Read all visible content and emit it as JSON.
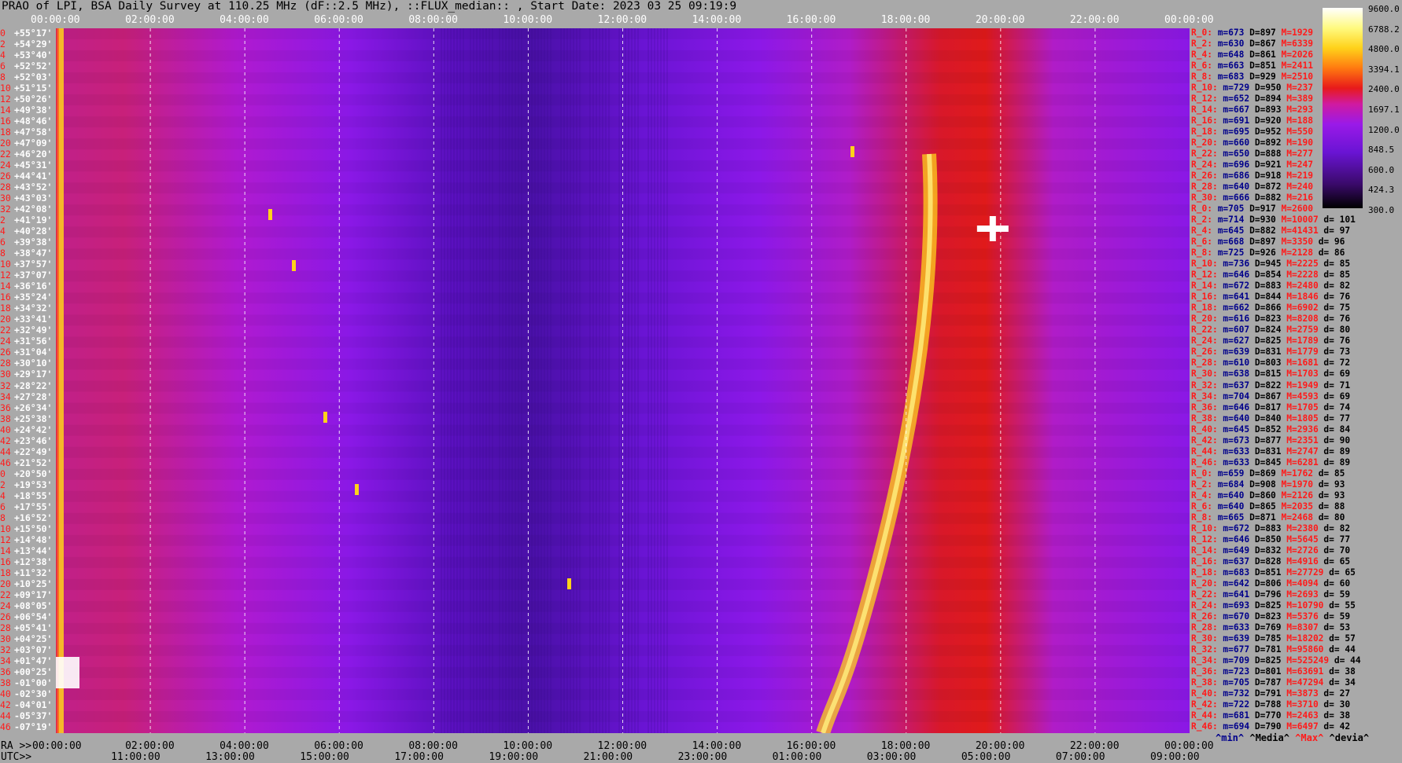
{
  "title": "PRAO of LPI, BSA Daily Survey at 110.25 MHz (dF::2.5 MHz), ::FLUX_median:: , Start Date: 2023 03 25 09:19:9",
  "top_ticks": [
    "00:00:00",
    "02:00:00",
    "04:00:00",
    "06:00:00",
    "08:00:00",
    "10:00:00",
    "12:00:00",
    "14:00:00",
    "16:00:00",
    "18:00:00",
    "20:00:00",
    "22:00:00",
    "00:00:00"
  ],
  "bottom_ticks_ra_prefix": "RA >>",
  "bottom_ticks": [
    "00:00:00",
    "02:00:00",
    "04:00:00",
    "06:00:00",
    "08:00:00",
    "10:00:00",
    "12:00:00",
    "14:00:00",
    "16:00:00",
    "18:00:00",
    "20:00:00",
    "22:00:00",
    "00:00:00"
  ],
  "utc_prefix": "UTC>>",
  "utc_ticks": [
    "11:00:00",
    "13:00:00",
    "15:00:00",
    "17:00:00",
    "19:00:00",
    "21:00:00",
    "23:00:00",
    "01:00:00",
    "03:00:00",
    "05:00:00",
    "07:00:00",
    "09:00:00"
  ],
  "declinations": [
    {
      "row": "0",
      "dec": "+55°17'"
    },
    {
      "row": "2",
      "dec": "+54°29'"
    },
    {
      "row": "4",
      "dec": "+53°40'"
    },
    {
      "row": "6",
      "dec": "+52°52'"
    },
    {
      "row": "8",
      "dec": "+52°03'"
    },
    {
      "row": "10",
      "dec": "+51°15'"
    },
    {
      "row": "12",
      "dec": "+50°26'"
    },
    {
      "row": "14",
      "dec": "+49°38'"
    },
    {
      "row": "16",
      "dec": "+48°46'"
    },
    {
      "row": "18",
      "dec": "+47°58'"
    },
    {
      "row": "20",
      "dec": "+47°09'"
    },
    {
      "row": "22",
      "dec": "+46°20'"
    },
    {
      "row": "24",
      "dec": "+45°31'"
    },
    {
      "row": "26",
      "dec": "+44°41'"
    },
    {
      "row": "28",
      "dec": "+43°52'"
    },
    {
      "row": "30",
      "dec": "+43°03'"
    },
    {
      "row": "32",
      "dec": "+42°08'"
    },
    {
      "row": "2",
      "dec": "+41°19'"
    },
    {
      "row": "4",
      "dec": "+40°28'"
    },
    {
      "row": "6",
      "dec": "+39°38'"
    },
    {
      "row": "8",
      "dec": "+38°47'"
    },
    {
      "row": "10",
      "dec": "+37°57'"
    },
    {
      "row": "12",
      "dec": "+37°07'"
    },
    {
      "row": "14",
      "dec": "+36°16'"
    },
    {
      "row": "16",
      "dec": "+35°24'"
    },
    {
      "row": "18",
      "dec": "+34°32'"
    },
    {
      "row": "20",
      "dec": "+33°41'"
    },
    {
      "row": "22",
      "dec": "+32°49'"
    },
    {
      "row": "24",
      "dec": "+31°56'"
    },
    {
      "row": "26",
      "dec": "+31°04'"
    },
    {
      "row": "28",
      "dec": "+30°10'"
    },
    {
      "row": "30",
      "dec": "+29°17'"
    },
    {
      "row": "32",
      "dec": "+28°22'"
    },
    {
      "row": "34",
      "dec": "+27°28'"
    },
    {
      "row": "36",
      "dec": "+26°34'"
    },
    {
      "row": "38",
      "dec": "+25°38'"
    },
    {
      "row": "40",
      "dec": "+24°42'"
    },
    {
      "row": "42",
      "dec": "+23°46'"
    },
    {
      "row": "44",
      "dec": "+22°49'"
    },
    {
      "row": "46",
      "dec": "+21°52'"
    },
    {
      "row": "0",
      "dec": "+20°50'"
    },
    {
      "row": "2",
      "dec": "+19°53'"
    },
    {
      "row": "4",
      "dec": "+18°55'"
    },
    {
      "row": "6",
      "dec": "+17°55'"
    },
    {
      "row": "8",
      "dec": "+16°52'"
    },
    {
      "row": "10",
      "dec": "+15°50'"
    },
    {
      "row": "12",
      "dec": "+14°48'"
    },
    {
      "row": "14",
      "dec": "+13°44'"
    },
    {
      "row": "16",
      "dec": "+12°38'"
    },
    {
      "row": "18",
      "dec": "+11°32'"
    },
    {
      "row": "20",
      "dec": "+10°25'"
    },
    {
      "row": "22",
      "dec": "+09°17'"
    },
    {
      "row": "24",
      "dec": "+08°05'"
    },
    {
      "row": "26",
      "dec": "+06°54'"
    },
    {
      "row": "28",
      "dec": "+05°41'"
    },
    {
      "row": "30",
      "dec": "+04°25'"
    },
    {
      "row": "32",
      "dec": "+03°07'"
    },
    {
      "row": "34",
      "dec": "+01°47'"
    },
    {
      "row": "36",
      "dec": "+00°25'"
    },
    {
      "row": "38",
      "dec": "-01°00'"
    },
    {
      "row": "40",
      "dec": "-02°30'"
    },
    {
      "row": "42",
      "dec": "-04°01'"
    },
    {
      "row": "44",
      "dec": "-05°37'"
    },
    {
      "row": "46",
      "dec": "-07°19'"
    }
  ],
  "stats": [
    [
      "R_0:",
      "m=673",
      "D=897",
      "M=1929",
      ""
    ],
    [
      "R_2:",
      "m=630",
      "D=867",
      "M=6339",
      ""
    ],
    [
      "R_4:",
      "m=648",
      "D=861",
      "M=2026",
      ""
    ],
    [
      "R_6:",
      "m=663",
      "D=851",
      "M=2411",
      ""
    ],
    [
      "R_8:",
      "m=683",
      "D=929",
      "M=2510",
      ""
    ],
    [
      "R_10:",
      "m=729",
      "D=950",
      "M=237",
      ""
    ],
    [
      "R_12:",
      "m=652",
      "D=894",
      "M=389",
      ""
    ],
    [
      "R_14:",
      "m=667",
      "D=893",
      "M=293",
      ""
    ],
    [
      "R_16:",
      "m=691",
      "D=920",
      "M=188",
      ""
    ],
    [
      "R_18:",
      "m=695",
      "D=952",
      "M=550",
      ""
    ],
    [
      "R_20:",
      "m=660",
      "D=892",
      "M=190",
      ""
    ],
    [
      "R_22:",
      "m=650",
      "D=888",
      "M=277",
      ""
    ],
    [
      "R_24:",
      "m=696",
      "D=921",
      "M=247",
      ""
    ],
    [
      "R_26:",
      "m=686",
      "D=918",
      "M=219",
      ""
    ],
    [
      "R_28:",
      "m=640",
      "D=872",
      "M=240",
      ""
    ],
    [
      "R_30:",
      "m=666",
      "D=882",
      "M=216",
      ""
    ],
    [
      "R_0:",
      "m=705",
      "D=917",
      "M=2600",
      ""
    ],
    [
      "R_2:",
      "m=714",
      "D=930",
      "M=10007",
      "d= 101"
    ],
    [
      "R_4:",
      "m=645",
      "D=882",
      "M=41431",
      "d= 97"
    ],
    [
      "R_6:",
      "m=668",
      "D=897",
      "M=3350",
      "d= 96"
    ],
    [
      "R_8:",
      "m=725",
      "D=926",
      "M=2128",
      "d= 86"
    ],
    [
      "R_10:",
      "m=736",
      "D=945",
      "M=2225",
      "d= 85"
    ],
    [
      "R_12:",
      "m=646",
      "D=854",
      "M=2228",
      "d= 85"
    ],
    [
      "R_14:",
      "m=672",
      "D=883",
      "M=2480",
      "d= 82"
    ],
    [
      "R_16:",
      "m=641",
      "D=844",
      "M=1846",
      "d= 76"
    ],
    [
      "R_18:",
      "m=662",
      "D=866",
      "M=6902",
      "d= 75"
    ],
    [
      "R_20:",
      "m=616",
      "D=823",
      "M=8208",
      "d= 76"
    ],
    [
      "R_22:",
      "m=607",
      "D=824",
      "M=2759",
      "d= 80"
    ],
    [
      "R_24:",
      "m=627",
      "D=825",
      "M=1789",
      "d= 76"
    ],
    [
      "R_26:",
      "m=639",
      "D=831",
      "M=1779",
      "d= 73"
    ],
    [
      "R_28:",
      "m=610",
      "D=803",
      "M=1681",
      "d= 72"
    ],
    [
      "R_30:",
      "m=638",
      "D=815",
      "M=1703",
      "d= 69"
    ],
    [
      "R_32:",
      "m=637",
      "D=822",
      "M=1949",
      "d= 71"
    ],
    [
      "R_34:",
      "m=704",
      "D=867",
      "M=4593",
      "d= 69"
    ],
    [
      "R_36:",
      "m=646",
      "D=817",
      "M=1705",
      "d= 74"
    ],
    [
      "R_38:",
      "m=640",
      "D=840",
      "M=1805",
      "d= 77"
    ],
    [
      "R_40:",
      "m=645",
      "D=852",
      "M=2936",
      "d= 84"
    ],
    [
      "R_42:",
      "m=673",
      "D=877",
      "M=2351",
      "d= 90"
    ],
    [
      "R_44:",
      "m=633",
      "D=831",
      "M=2747",
      "d= 89"
    ],
    [
      "R_46:",
      "m=633",
      "D=845",
      "M=6281",
      "d= 89"
    ],
    [
      "R_0:",
      "m=659",
      "D=869",
      "M=1762",
      "d= 85"
    ],
    [
      "R_2:",
      "m=684",
      "D=908",
      "M=1970",
      "d= 93"
    ],
    [
      "R_4:",
      "m=640",
      "D=860",
      "M=2126",
      "d= 93"
    ],
    [
      "R_6:",
      "m=640",
      "D=865",
      "M=2035",
      "d= 88"
    ],
    [
      "R_8:",
      "m=665",
      "D=871",
      "M=2468",
      "d= 80"
    ],
    [
      "R_10:",
      "m=672",
      "D=883",
      "M=2380",
      "d= 82"
    ],
    [
      "R_12:",
      "m=646",
      "D=850",
      "M=5645",
      "d= 77"
    ],
    [
      "R_14:",
      "m=649",
      "D=832",
      "M=2726",
      "d= 70"
    ],
    [
      "R_16:",
      "m=637",
      "D=828",
      "M=4916",
      "d= 65"
    ],
    [
      "R_18:",
      "m=683",
      "D=851",
      "M=27729",
      "d= 65"
    ],
    [
      "R_20:",
      "m=642",
      "D=806",
      "M=4094",
      "d= 60"
    ],
    [
      "R_22:",
      "m=641",
      "D=796",
      "M=2693",
      "d= 59"
    ],
    [
      "R_24:",
      "m=693",
      "D=825",
      "M=10790",
      "d= 55"
    ],
    [
      "R_26:",
      "m=670",
      "D=823",
      "M=5376",
      "d= 59"
    ],
    [
      "R_28:",
      "m=633",
      "D=769",
      "M=8307",
      "d= 53"
    ],
    [
      "R_30:",
      "m=639",
      "D=785",
      "M=18202",
      "d= 57"
    ],
    [
      "R_32:",
      "m=677",
      "D=781",
      "M=95860",
      "d= 44"
    ],
    [
      "R_34:",
      "m=709",
      "D=825",
      "M=525249",
      "d= 44"
    ],
    [
      "R_36:",
      "m=723",
      "D=801",
      "M=63691",
      "d= 38"
    ],
    [
      "R_38:",
      "m=705",
      "D=787",
      "M=47294",
      "d= 34"
    ],
    [
      "R_40:",
      "m=732",
      "D=791",
      "M=3873",
      "d= 27"
    ],
    [
      "R_42:",
      "m=722",
      "D=788",
      "M=3710",
      "d= 30"
    ],
    [
      "R_44:",
      "m=681",
      "D=770",
      "M=2463",
      "d= 38"
    ],
    [
      "R_46:",
      "m=694",
      "D=790",
      "M=6497",
      "d= 42"
    ]
  ],
  "colorbar_labels": [
    "9600.0",
    "6788.2",
    "4800.0",
    "3394.1",
    "2400.0",
    "1697.1",
    "1200.0",
    "848.5",
    "600.0",
    "424.3",
    "300.0"
  ],
  "legend": {
    "min": "^min^",
    "median": "^Media^",
    "max": "^Max^",
    "dev": "^devia^"
  },
  "chart_data": {
    "type": "heatmap",
    "title": "PRAO of LPI, BSA Daily Survey at 110.25 MHz (dF::2.5 MHz), ::FLUX_median:: , Start Date: 2023 03 25 09:19:9",
    "x_axis": "RA 00:00:00 to 00:00:00 (24h), UTC 09:19 to 09:19 next day",
    "y_axis": "Declination +55°17' to -07°19'",
    "color_scale": "log",
    "color_range": [
      300.0,
      9600.0
    ],
    "grid": true,
    "gridlines_ra_hours": [
      2,
      4,
      6,
      8,
      10,
      12,
      14,
      16,
      18,
      20,
      22
    ],
    "notable_sources": [
      {
        "ra_h": 0.2,
        "note": "bright column near RA 00h"
      },
      {
        "ra_h": 20.0,
        "dec": "+40°28'",
        "note": "bright spot"
      },
      {
        "ra_h": 19.0,
        "note": "galactic plane band bright, Max up to 525249"
      }
    ]
  }
}
